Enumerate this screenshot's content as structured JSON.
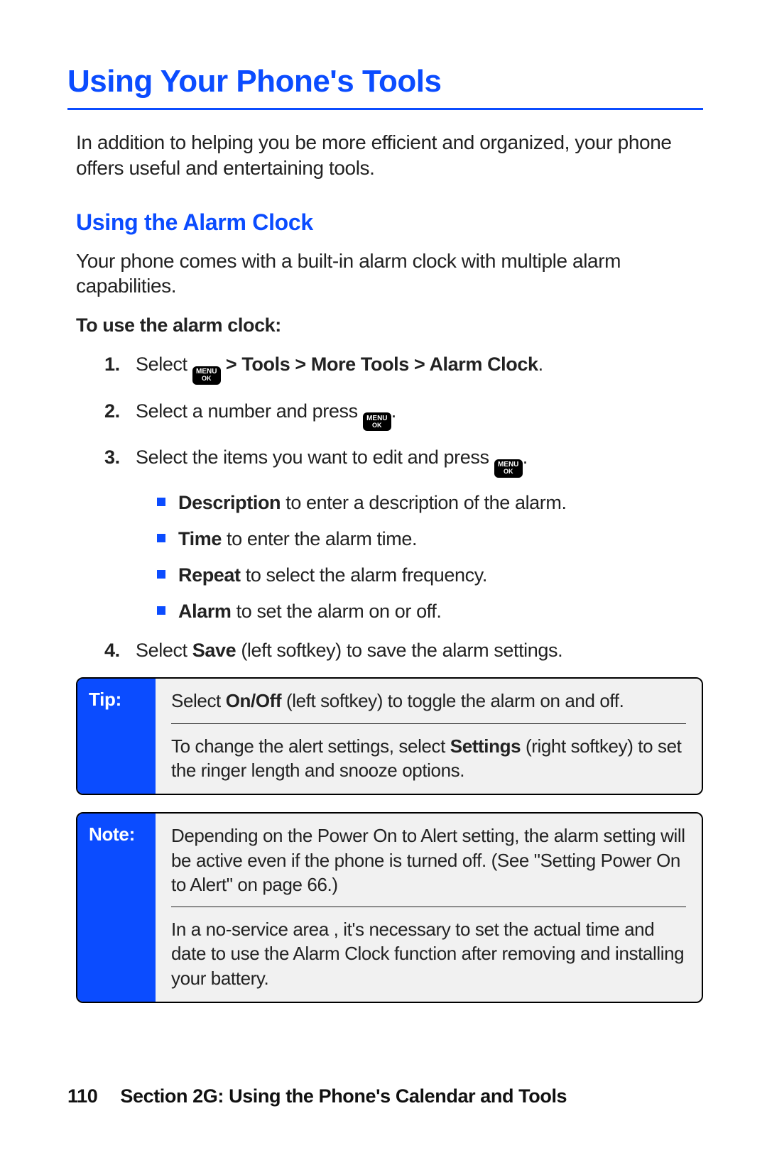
{
  "title": "Using Your Phone's Tools",
  "intro": "In addition to helping you be more efficient and organized, your phone offers useful and entertaining tools.",
  "section": {
    "title": "Using the Alarm Clock",
    "intro": "Your phone comes with a built-in alarm clock with multiple alarm capabilities.",
    "task_heading": "To use the alarm clock:",
    "menu_key": {
      "line1": "MENU",
      "line2": "OK"
    },
    "step1": {
      "before": "Select ",
      "after_bold": " > Tools > More Tools > Alarm Clock",
      "period": "."
    },
    "step2": {
      "before": "Select a number and press ",
      "after": "."
    },
    "step3": {
      "before": "Select the items you want to edit and press ",
      "after": ".",
      "bullets": [
        {
          "bold": "Description",
          "rest": " to enter a description of the alarm."
        },
        {
          "bold": "Time",
          "rest": " to enter the alarm time."
        },
        {
          "bold": "Repeat",
          "rest": " to select the alarm frequency."
        },
        {
          "bold": "Alarm",
          "rest": " to set the alarm on or off."
        }
      ]
    },
    "step4": {
      "before": "Select ",
      "bold": "Save",
      "after": " (left softkey) to save the alarm settings."
    }
  },
  "tip": {
    "label": "Tip:",
    "p1": {
      "before": "Select ",
      "bold": "On/Off",
      "after": " (left softkey) to toggle the alarm on and off."
    },
    "p2": {
      "before": "To change the alert settings, select ",
      "bold": "Settings",
      "after": " (right softkey) to set the ringer length and snooze options."
    }
  },
  "note": {
    "label": "Note:",
    "p1": "Depending on the Power On to Alert setting, the alarm setting will be active even if the phone is turned off. (See \"Setting Power On to Alert\" on page 66.)",
    "p2": "In a no-service area , it's necessary to set the actual time and date to use the Alarm Clock function after removing and installing your battery."
  },
  "footer": {
    "page_number": "110",
    "text": "Section 2G: Using the Phone's Calendar and Tools"
  }
}
